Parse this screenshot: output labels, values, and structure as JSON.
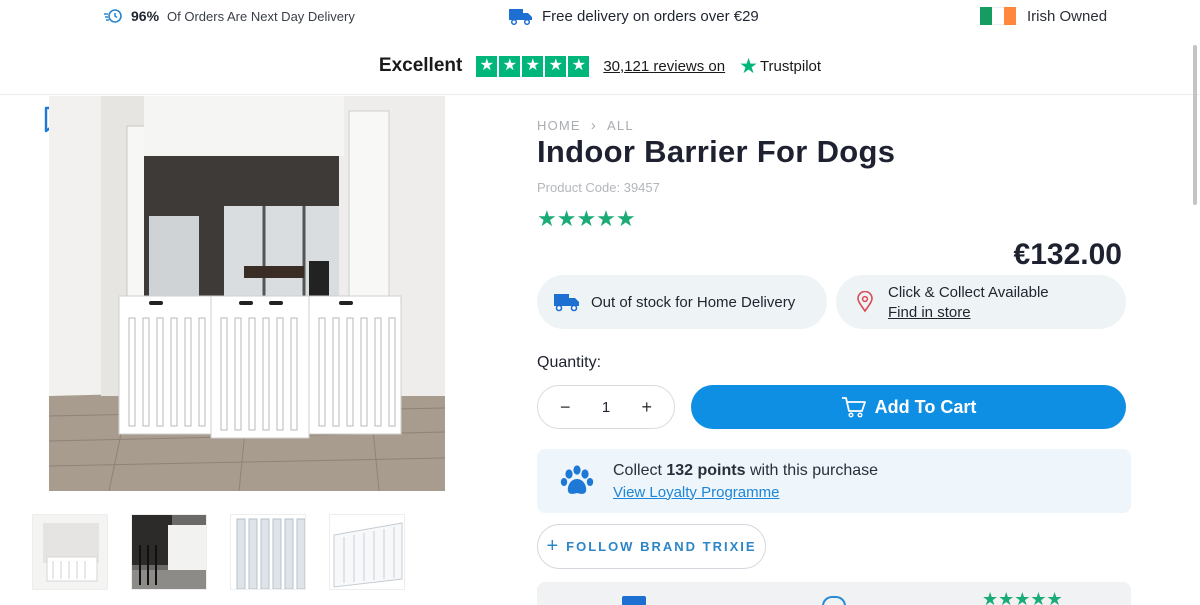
{
  "topbar": {
    "next_day_percent": "96%",
    "next_day_text": "Of Orders Are Next Day Delivery",
    "free_delivery": "Free delivery on orders over €29",
    "irish_owned": "Irish Owned"
  },
  "trustpilot": {
    "rating_word": "Excellent",
    "reviews_count": "30,121",
    "reviews_suffix": "reviews on",
    "brand": "Trustpilot"
  },
  "breadcrumb": {
    "home": "HOME",
    "separator": "›",
    "all": "ALL"
  },
  "product": {
    "title": "Indoor Barrier For Dogs",
    "code": "Product Code: 39457",
    "stars": "★★★★★",
    "price": "€132.00"
  },
  "delivery": {
    "home_status": "Out of stock for Home Delivery",
    "collect_title": "Click & Collect Available",
    "collect_link": "Find in store"
  },
  "quantity": {
    "label": "Quantity:",
    "value": "1",
    "minus": "−",
    "plus": "+"
  },
  "cart": {
    "label": "Add To Cart"
  },
  "loyalty": {
    "prefix": "Collect",
    "points": "132 points",
    "suffix": "with this purchase",
    "link": "View Loyalty Programme"
  },
  "follow": {
    "plus": "+",
    "label": "FOLLOW BRAND TRIXIE"
  },
  "bottom": {
    "stars": "★★★★★"
  },
  "colors": {
    "trustpilot_green": "#00b67a",
    "star_green": "#1aab77",
    "cart_blue": "#0e8fe3",
    "link_blue": "#1e86d6",
    "flag": [
      "#169b62",
      "#ffffff",
      "#ff883e"
    ]
  },
  "icons": {
    "delivery": "clock-delivery-icon",
    "truck": "truck-icon",
    "bookmark": "bookmark-icon",
    "pin": "location-pin-icon",
    "cart": "cart-icon",
    "paw": "paw-icon"
  }
}
